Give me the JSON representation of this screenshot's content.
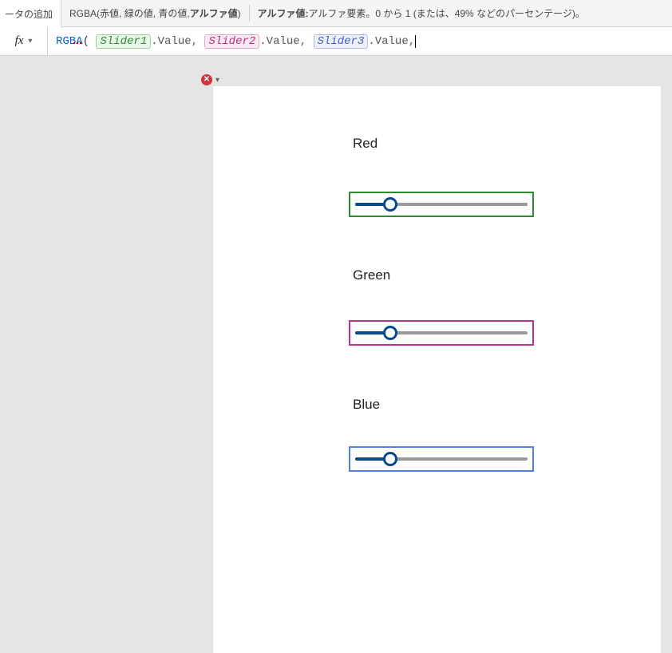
{
  "header": {
    "tab": "ータの追加",
    "signature_prefix": "RGBA(",
    "signature_args": "赤値, 緑の値, 青の値, ",
    "signature_bold_arg": "アルファ値",
    "signature_suffix": ")",
    "param_label": "アルファ値:",
    "param_desc": " アルファ要素。0 から 1 (または、49% などのパーセンテージ)。"
  },
  "formula": {
    "fx": "fx",
    "fn": "RGBA",
    "open": "( ",
    "var1": "Slider1",
    "var2": "Slider2",
    "var3": "Slider3",
    "prop": ".Value",
    "comma": ", ",
    "last_comma": ","
  },
  "error": {
    "glyph": "✕"
  },
  "canvas": {
    "labels": {
      "red": "Red",
      "green": "Green",
      "blue": "Blue"
    },
    "sliders": {
      "red": {
        "min": 0,
        "max": 255,
        "value": 50
      },
      "green": {
        "min": 0,
        "max": 255,
        "value": 50
      },
      "blue": {
        "min": 0,
        "max": 255,
        "value": 50
      }
    }
  }
}
